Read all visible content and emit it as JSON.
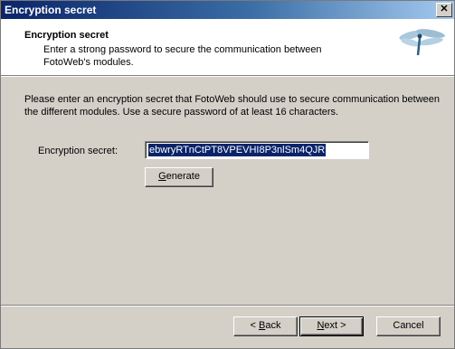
{
  "window": {
    "title": "Encryption secret"
  },
  "header": {
    "title": "Encryption secret",
    "description": "Enter a strong password to secure the communication between FotoWeb's modules."
  },
  "body": {
    "intro": "Please enter an encryption secret that FotoWeb should use to secure communication between the different modules. Use a secure password of at least 16 characters.",
    "field_label": "Encryption secret:",
    "field_value": "ebwryRTnCtPT8VPEVHI8P3nlSm4QJR",
    "generate_prefix": "",
    "generate_accel": "G",
    "generate_rest": "enerate"
  },
  "footer": {
    "back_prefix": "< ",
    "back_accel": "B",
    "back_rest": "ack",
    "next_prefix": "",
    "next_accel": "N",
    "next_rest": "ext >",
    "cancel_label": "Cancel"
  },
  "icons": {
    "logo": "dragonfly-icon",
    "close": "close-icon"
  }
}
